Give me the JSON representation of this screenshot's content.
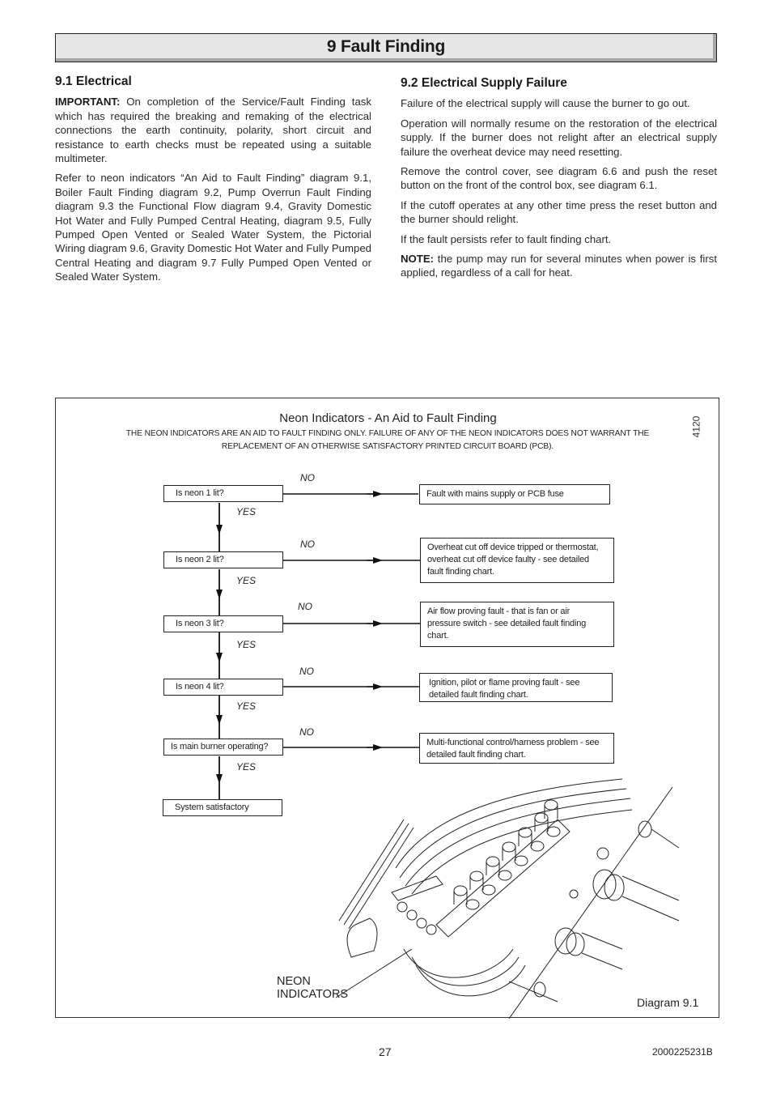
{
  "header": {
    "title": "9 Fault Finding"
  },
  "section_electrical": {
    "heading": "9.1 Electrical",
    "important_label": "IMPORTANT:",
    "important_text": " On completion of the Service/Fault Finding task which has required the breaking and remaking of the electrical connections the earth continuity, polarity, short circuit and resistance to earth checks must be repeated using a suitable multimeter.",
    "refer_text": "Refer to neon indicators “An Aid to Fault Finding” diagram 9.1, Boiler Fault Finding diagram 9.2, Pump Overrun Fault Finding diagram 9.3 the Functional Flow diagram 9.4, Gravity Domestic Hot Water and Fully Pumped  Central Heating, diagram 9.5, Fully Pumped Open Vented or Sealed Water System, the Pictorial Wiring diagram 9.6, Gravity Domestic Hot Water and Fully Pumped Central Heating and diagram 9.7 Fully Pumped Open Vented or Sealed Water System."
  },
  "section_supply": {
    "heading": "9.2 Electrical Supply Failure",
    "paragraphs": [
      "Failure of the electrical supply will cause the burner to go out.",
      "Operation will normally resume on the restoration of the electrical supply.  If the burner does not relight after an electrical supply failure the overheat device may need resetting.",
      "Remove the control cover, see diagram 6.6 and push the reset button on the front of the control box, see diagram 6.1.",
      "If the cutoff operates at any other time press the reset button and the burner should relight.",
      "If the fault persists refer to fault finding chart."
    ],
    "note_label": "NOTE:",
    "note_text": " the pump may run for several minutes when power is first applied, regardless of a call for heat."
  },
  "diagram": {
    "title": "Neon Indicators - An Aid to Fault Finding",
    "note": "THE NEON INDICATORS ARE AN AID TO FAULT FINDING ONLY.  FAILURE OF ANY OF THE NEON INDICATORS DOES NOT WARRANT THE REPLACEMENT  OF AN OTHERWISE SATISFACTORY PRINTED CIRCUIT BOARD (PCB).",
    "code": "4120",
    "yes_label": "YES",
    "no_label": "NO",
    "steps": [
      {
        "question": "Is neon 1 lit?",
        "fault": "Fault with mains supply or PCB fuse"
      },
      {
        "question": "Is neon 2 lit?",
        "fault": "Overheat  cut off device tripped or thermostat, overheat cut off device faulty - see detailed fault finding chart."
      },
      {
        "question": "Is neon 3 lit?",
        "fault": "Air flow proving fault - that is fan or air pressure switch - see detailed fault finding chart."
      },
      {
        "question": "Is neon 4 lit?",
        "fault": "Ignition, pilot or flame proving fault - see detailed fault finding chart."
      },
      {
        "question": "Is main burner operating?",
        "fault": "Multi-functional control/harness problem - see detailed fault finding chart."
      }
    ],
    "final": "System satisfactory",
    "illustration_label": "NEON INDICATORS",
    "diagram_number": "Diagram 9.1"
  },
  "footer": {
    "page_number": "27",
    "doc_code": "2000225231B"
  }
}
